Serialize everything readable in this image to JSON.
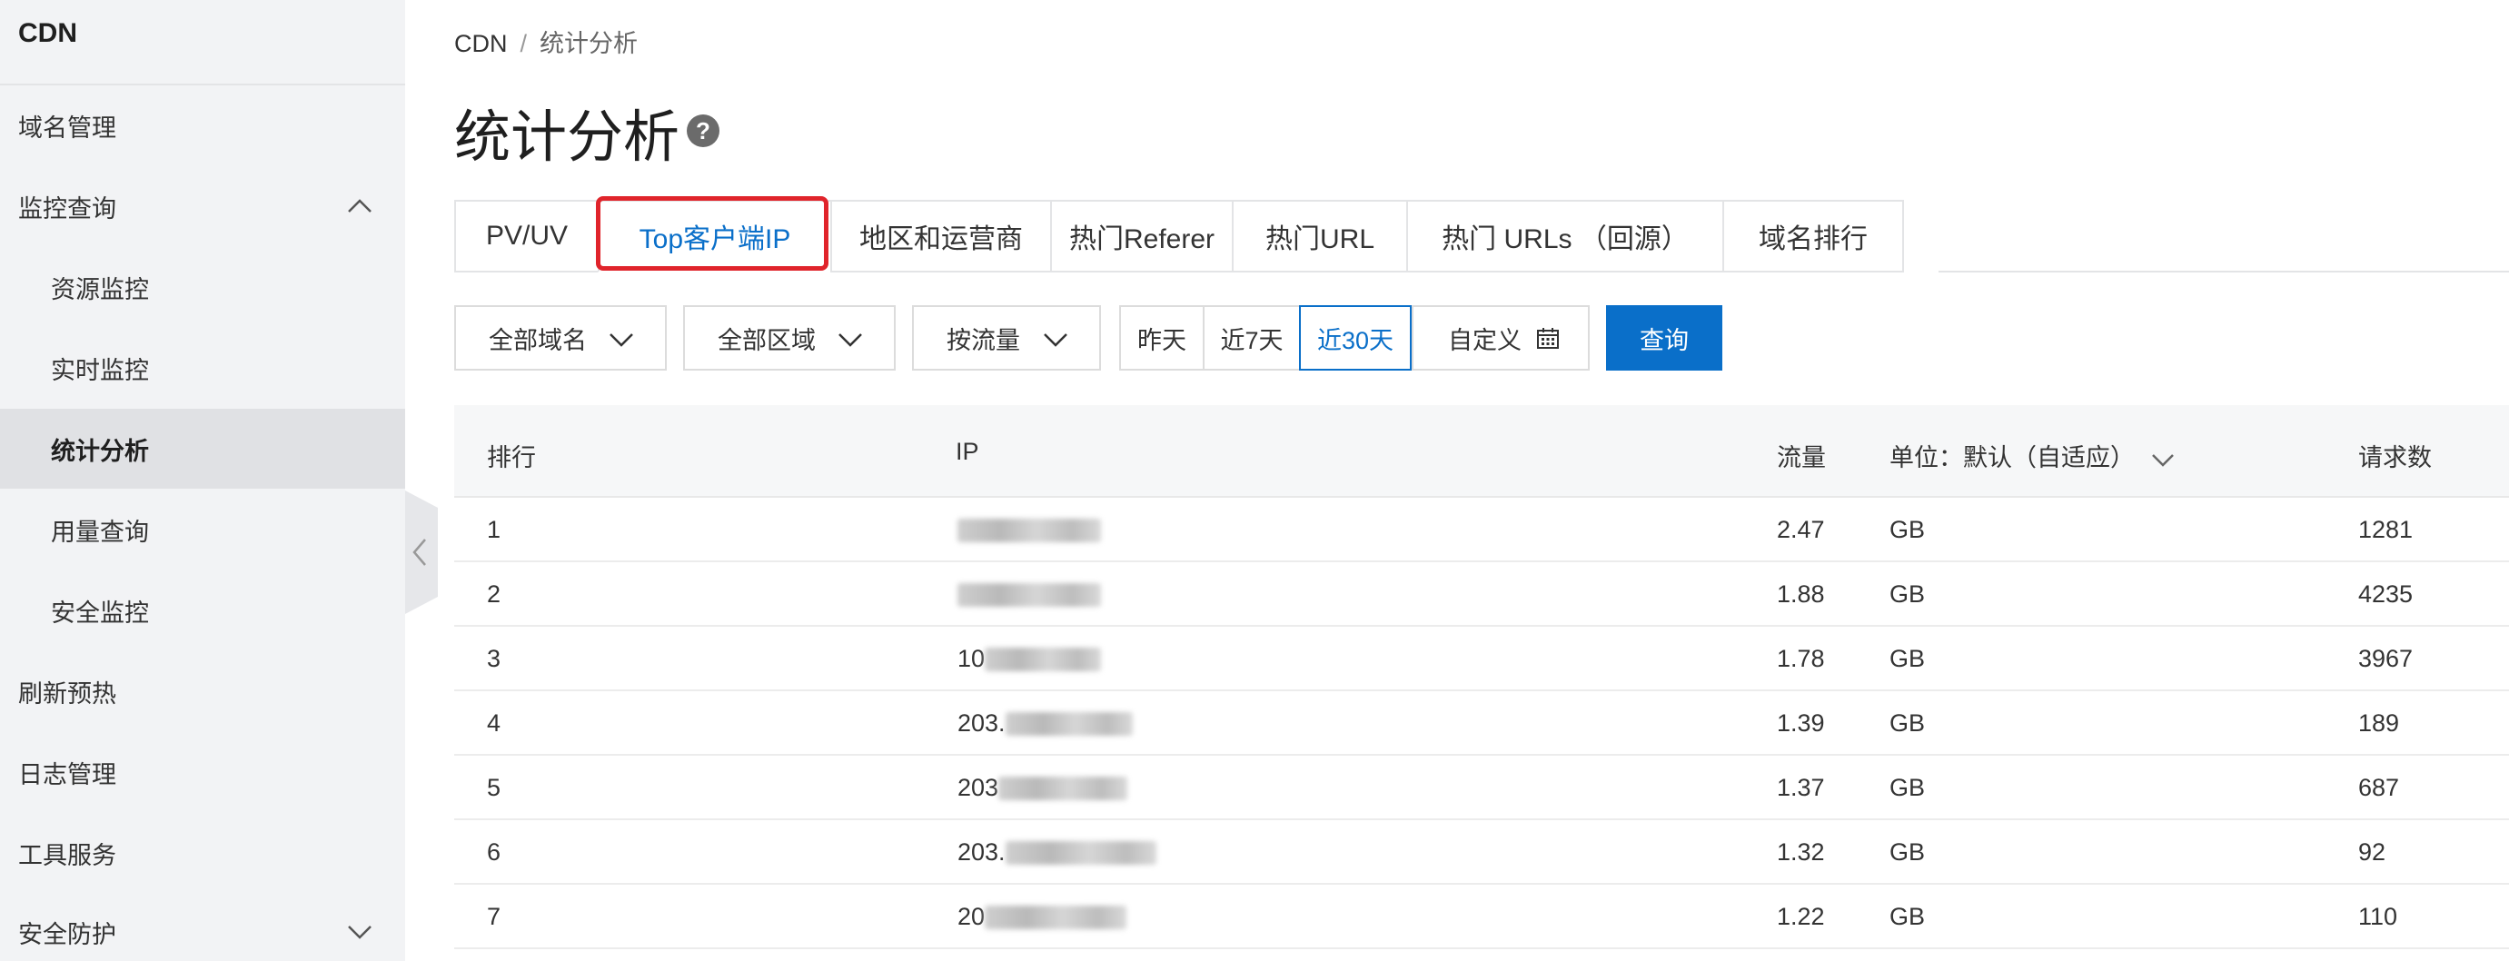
{
  "sidebar": {
    "title": "CDN",
    "items": [
      {
        "label": "域名管理"
      },
      {
        "label": "监控查询"
      },
      {
        "label": "资源监控"
      },
      {
        "label": "实时监控"
      },
      {
        "label": "统计分析"
      },
      {
        "label": "用量查询"
      },
      {
        "label": "安全监控"
      },
      {
        "label": "刷新预热"
      },
      {
        "label": "日志管理"
      },
      {
        "label": "工具服务"
      },
      {
        "label": "安全防护"
      }
    ]
  },
  "breadcrumb": {
    "root": "CDN",
    "separator": "/",
    "current": "统计分析"
  },
  "page": {
    "title": "统计分析",
    "help_symbol": "?"
  },
  "tabs": [
    {
      "label": "PV/UV"
    },
    {
      "label": "Top客户端IP",
      "active": true
    },
    {
      "label": "地区和运营商"
    },
    {
      "label": "热门Referer"
    },
    {
      "label": "热门URL"
    },
    {
      "label": "热门 URLs （回源）"
    },
    {
      "label": "域名排行"
    }
  ],
  "filters": {
    "domain": "全部域名",
    "region": "全部区域",
    "metric": "按流量",
    "dates": [
      {
        "label": "昨天"
      },
      {
        "label": "近7天"
      },
      {
        "label": "近30天",
        "active": true
      }
    ],
    "custom": "自定义",
    "query_button": "查询"
  },
  "table": {
    "headers": {
      "rank": "排行",
      "ip": "IP",
      "traffic": "流量",
      "unit": "单位：默认（自适应）",
      "requests": "请求数"
    },
    "rows": [
      {
        "rank": "1",
        "ip_visible": "",
        "traffic": "2.47",
        "unit": "GB",
        "requests": "1281"
      },
      {
        "rank": "2",
        "ip_visible": "",
        "traffic": "1.88",
        "unit": "GB",
        "requests": "4235"
      },
      {
        "rank": "3",
        "ip_visible": "10",
        "traffic": "1.78",
        "unit": "GB",
        "requests": "3967"
      },
      {
        "rank": "4",
        "ip_visible": "203.",
        "traffic": "1.39",
        "unit": "GB",
        "requests": "189"
      },
      {
        "rank": "5",
        "ip_visible": "203",
        "traffic": "1.37",
        "unit": "GB",
        "requests": "687"
      },
      {
        "rank": "6",
        "ip_visible": "203.",
        "traffic": "1.32",
        "unit": "GB",
        "requests": "92"
      },
      {
        "rank": "7",
        "ip_visible": "20",
        "traffic": "1.22",
        "unit": "GB",
        "requests": "110"
      }
    ]
  },
  "colors": {
    "accent": "#0a6fc9",
    "highlight": "#e0242b",
    "sidebar_bg": "#f2f3f5"
  }
}
